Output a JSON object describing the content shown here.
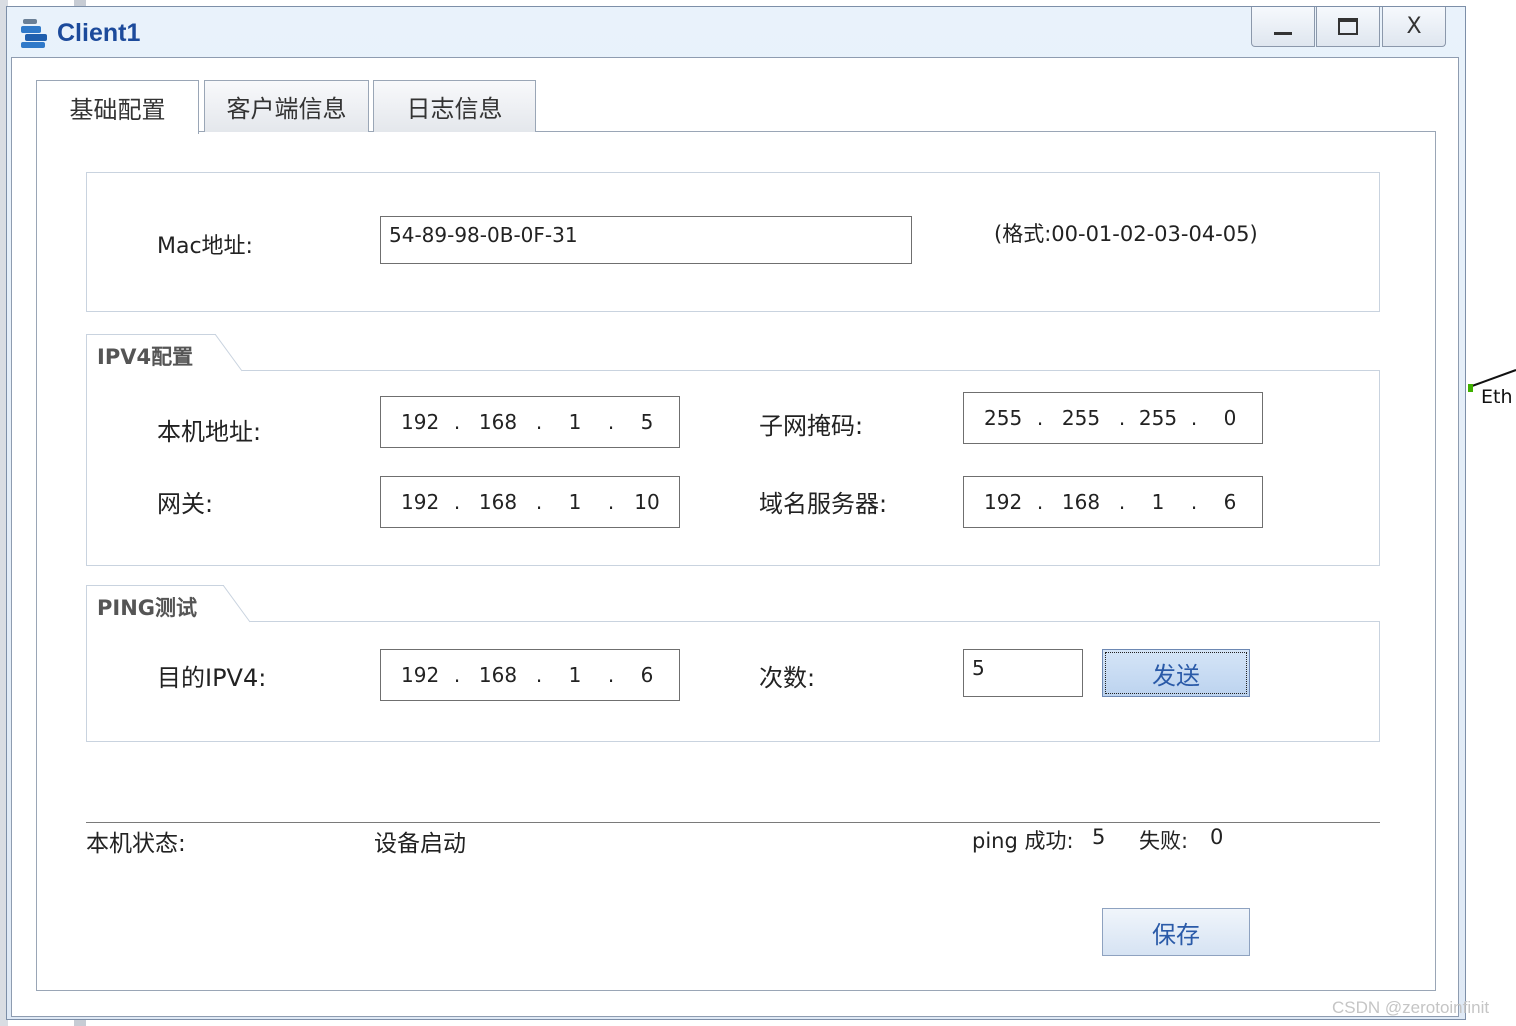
{
  "window": {
    "title": "Client1"
  },
  "titlebar_buttons": {
    "minimize": "—",
    "maximize": "☐",
    "close": "X"
  },
  "tabs": [
    {
      "label": "基础配置",
      "active": true
    },
    {
      "label": "客户端信息",
      "active": false
    },
    {
      "label": "日志信息",
      "active": false
    }
  ],
  "mac": {
    "label": "Mac地址:",
    "value": "54-89-98-0B-0F-31",
    "format_hint": "(格式:00-01-02-03-04-05)"
  },
  "ipv4": {
    "group_title": "IPV4配置",
    "local_address": {
      "label": "本机地址:",
      "octets": [
        "192",
        "168",
        "1",
        "5"
      ]
    },
    "subnet_mask": {
      "label": "子网掩码:",
      "octets": [
        "255",
        "255",
        "255",
        "0"
      ]
    },
    "gateway": {
      "label": "网关:",
      "octets": [
        "192",
        "168",
        "1",
        "10"
      ]
    },
    "dns_server": {
      "label": "域名服务器:",
      "octets": [
        "192",
        "168",
        "1",
        "6"
      ]
    }
  },
  "ping": {
    "group_title": "PING测试",
    "target": {
      "label": "目的IPV4:",
      "octets": [
        "192",
        "168",
        "1",
        "6"
      ]
    },
    "count": {
      "label": "次数:",
      "value": "5"
    },
    "send_label": "发送"
  },
  "status": {
    "label": "本机状态:",
    "value": "设备启动",
    "ping_success_label": "ping 成功:",
    "ping_success_value": "5",
    "fail_label": "失败:",
    "fail_value": "0"
  },
  "save_label": "保存",
  "background": {
    "eth_label": "Eth"
  },
  "watermark": "CSDN @zerotoinfinit",
  "colors": {
    "title": "#1c4a9b",
    "button_text": "#2a5aa8",
    "accent_port": "#3fb000"
  }
}
